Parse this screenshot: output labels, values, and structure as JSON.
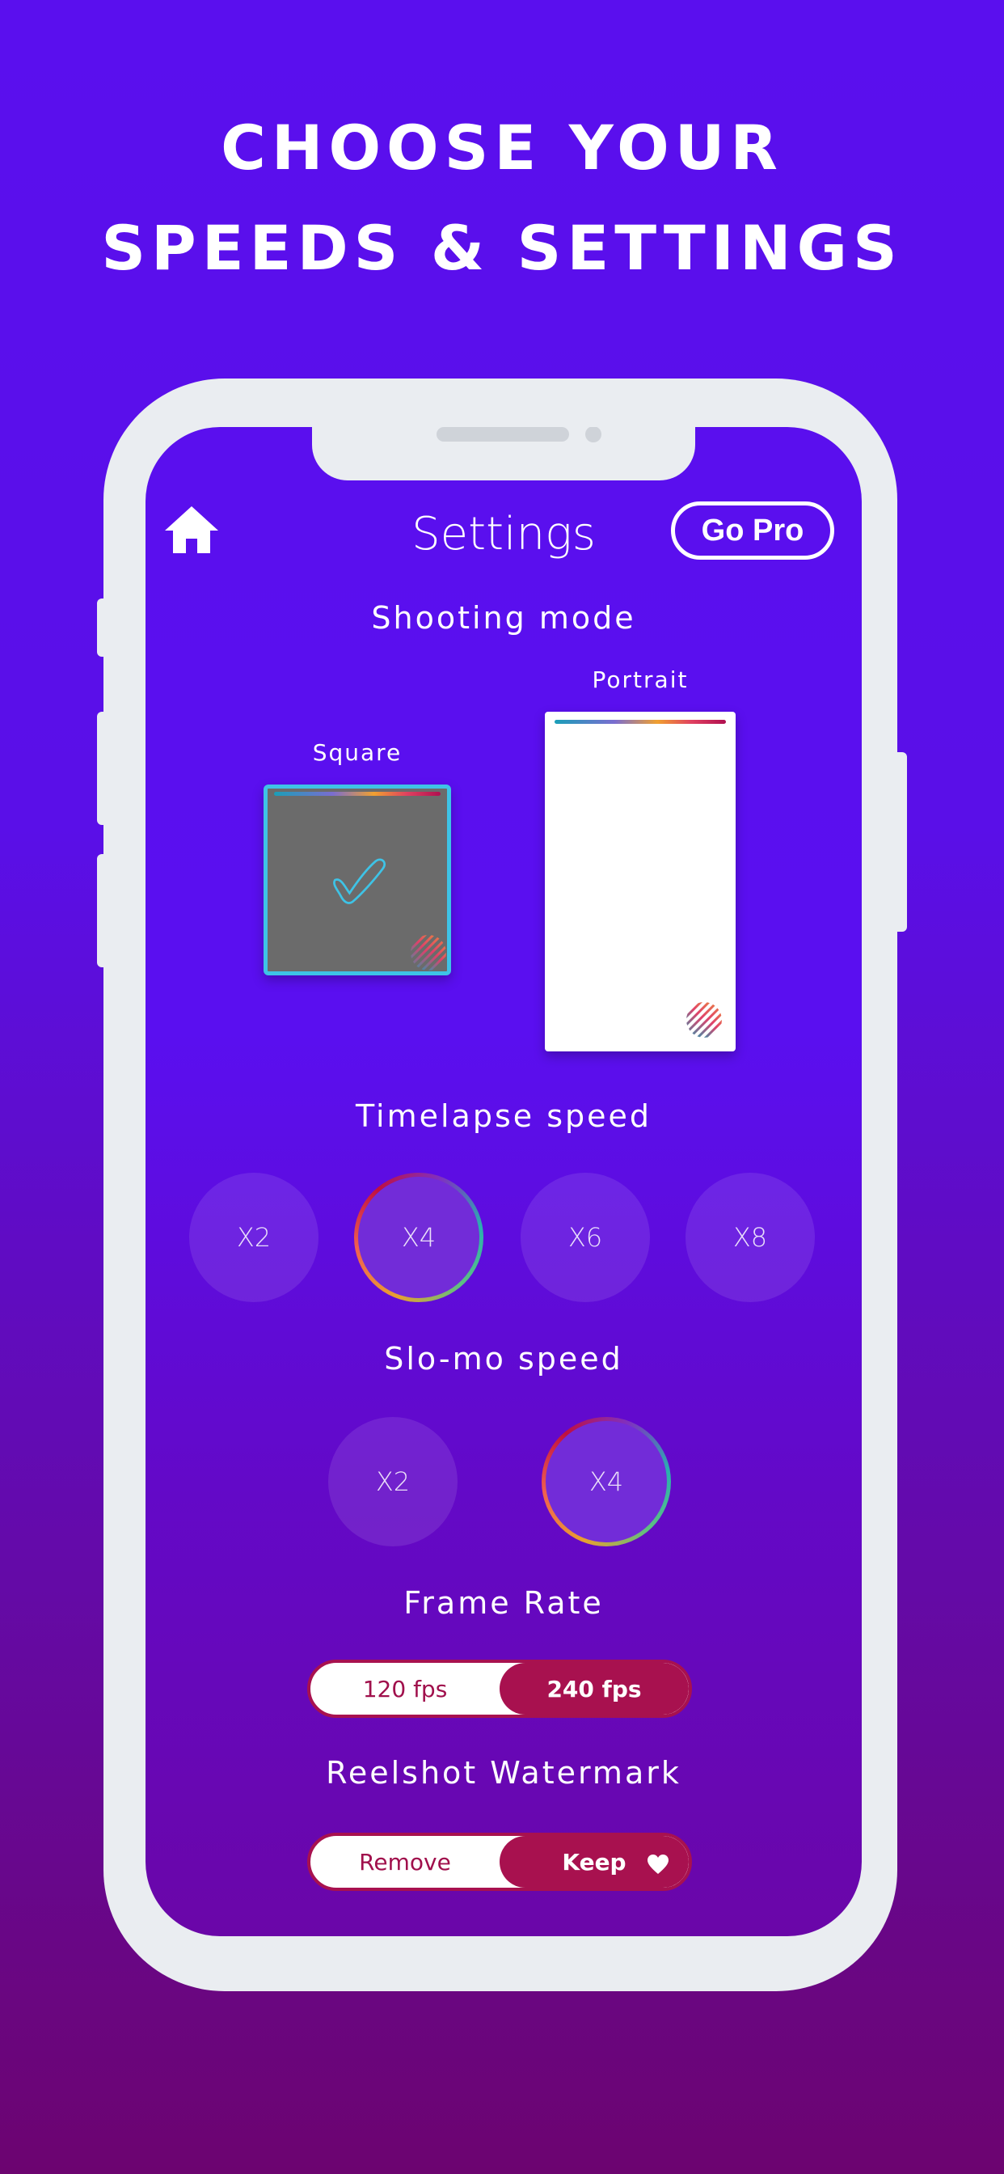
{
  "headline": {
    "line1": "CHOOSE YOUR",
    "line2": "SPEEDS & SETTINGS"
  },
  "colors": {
    "background_top": "#5a0fee",
    "background_bottom": "#6c0470",
    "accent_magenta": "#a8114f",
    "selected_border": "#3ec3e6",
    "phone_frame": "#eaedf1"
  },
  "header": {
    "home_icon": "home-icon",
    "title": "Settings",
    "go_pro_label": "Go Pro"
  },
  "shooting_mode": {
    "label": "Shooting mode",
    "square_label": "Square",
    "portrait_label": "Portrait",
    "selected": "Square",
    "selected_icon": "checkmark-icon"
  },
  "timelapse": {
    "label": "Timelapse speed",
    "options": [
      "X2",
      "X4",
      "X6",
      "X8"
    ],
    "selected": "X4"
  },
  "slomo": {
    "label": "Slo-mo speed",
    "options": [
      "X2",
      "X4"
    ],
    "selected": "X4"
  },
  "frame_rate": {
    "label": "Frame Rate",
    "options": [
      "120 fps",
      "240 fps"
    ],
    "selected": "240 fps"
  },
  "watermark": {
    "label": "Reelshot Watermark",
    "options": [
      "Remove",
      "Keep"
    ],
    "selected": "Keep",
    "keep_icon": "heart-icon"
  }
}
